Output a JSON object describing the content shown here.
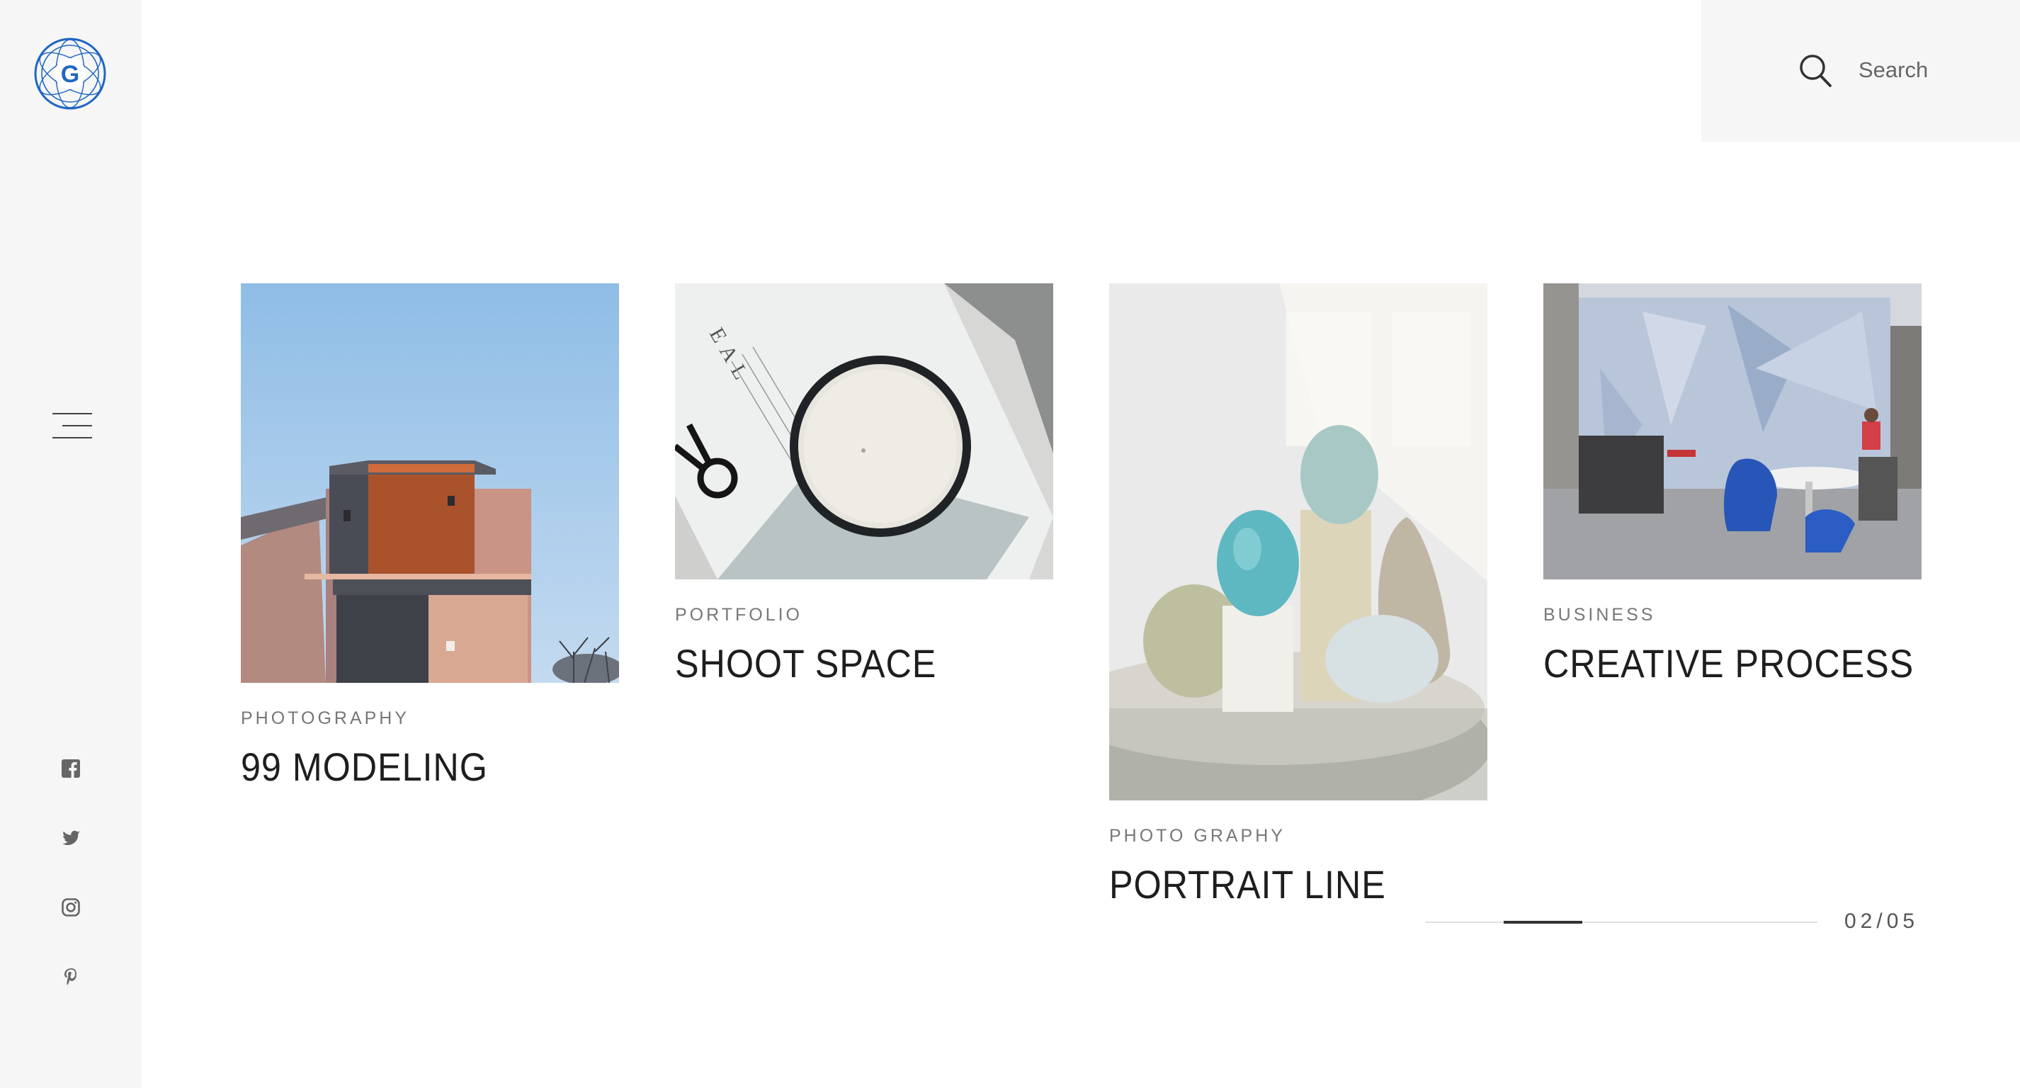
{
  "header": {
    "search": {
      "placeholder": "Search",
      "value": ""
    }
  },
  "sidebar": {
    "logo_letter": "G",
    "social": [
      "facebook-icon",
      "twitter-icon",
      "instagram-icon",
      "pinterest-icon"
    ]
  },
  "cards": [
    {
      "category": "PHOTOGRAPHY",
      "title": "99 MODELING"
    },
    {
      "category": "PORTFOLIO",
      "title": "SHOOT SPACE"
    },
    {
      "category": "PHOTO GRAPHY",
      "title": "PORTRAIT LINE"
    },
    {
      "category": "BUSINESS",
      "title": "CREATIVE PROCESS"
    }
  ],
  "slider": {
    "pager": "02/05",
    "progress": 0.2
  },
  "colors": {
    "sidebar_bg": "#f6f6f6",
    "logo_blue": "#1f66c2",
    "icon_gray": "#666666"
  }
}
